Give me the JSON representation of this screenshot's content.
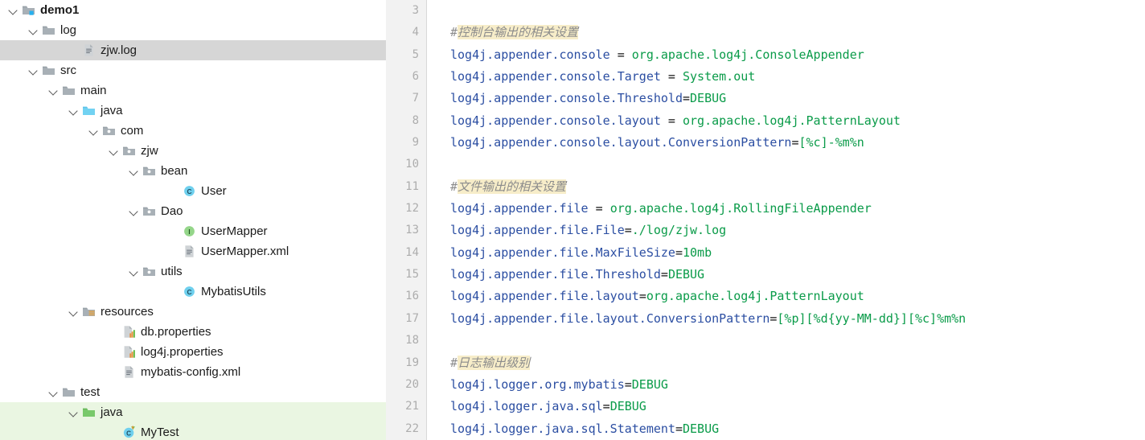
{
  "sidebar": {
    "name": "project-tree",
    "selected_item": "zjw.log",
    "highlight_colors": {
      "selected_row": "#d6d6d6",
      "test_source_root_row": "#eaf6e2"
    },
    "items": [
      {
        "label": "demo1",
        "icon": "module-folder-icon",
        "depth": 1,
        "arrow": "open",
        "bold": true,
        "state": "normal"
      },
      {
        "label": "log",
        "icon": "folder-icon",
        "depth": 2,
        "arrow": "open",
        "bold": false,
        "state": "normal"
      },
      {
        "label": "zjw.log",
        "icon": "text-file-icon",
        "depth": 4,
        "arrow": "none",
        "bold": false,
        "state": "selected"
      },
      {
        "label": "src",
        "icon": "folder-icon",
        "depth": 2,
        "arrow": "open",
        "bold": false,
        "state": "normal"
      },
      {
        "label": "main",
        "icon": "folder-icon",
        "depth": 3,
        "arrow": "open",
        "bold": false,
        "state": "normal"
      },
      {
        "label": "java",
        "icon": "source-root-folder-icon",
        "depth": 4,
        "arrow": "open",
        "bold": false,
        "state": "normal"
      },
      {
        "label": "com",
        "icon": "package-folder-icon",
        "depth": 5,
        "arrow": "open",
        "bold": false,
        "state": "normal"
      },
      {
        "label": "zjw",
        "icon": "package-folder-icon",
        "depth": 6,
        "arrow": "open",
        "bold": false,
        "state": "normal"
      },
      {
        "label": "bean",
        "icon": "package-folder-icon",
        "depth": 7,
        "arrow": "open",
        "bold": false,
        "state": "normal"
      },
      {
        "label": "User",
        "icon": "java-class-icon",
        "depth": 9,
        "arrow": "none",
        "bold": false,
        "state": "normal"
      },
      {
        "label": "Dao",
        "icon": "package-folder-icon",
        "depth": 7,
        "arrow": "open",
        "bold": false,
        "state": "normal"
      },
      {
        "label": "UserMapper",
        "icon": "java-interface-icon",
        "depth": 9,
        "arrow": "none",
        "bold": false,
        "state": "normal"
      },
      {
        "label": "UserMapper.xml",
        "icon": "xml-file-icon",
        "depth": 9,
        "arrow": "none",
        "bold": false,
        "state": "normal"
      },
      {
        "label": "utils",
        "icon": "package-folder-icon",
        "depth": 7,
        "arrow": "open",
        "bold": false,
        "state": "normal"
      },
      {
        "label": "MybatisUtils",
        "icon": "java-class-icon",
        "depth": 9,
        "arrow": "none",
        "bold": false,
        "state": "normal"
      },
      {
        "label": "resources",
        "icon": "resource-root-folder-icon",
        "depth": 4,
        "arrow": "open",
        "bold": false,
        "state": "normal"
      },
      {
        "label": "db.properties",
        "icon": "properties-file-icon",
        "depth": 6,
        "arrow": "none",
        "bold": false,
        "state": "normal"
      },
      {
        "label": "log4j.properties",
        "icon": "properties-file-icon",
        "depth": 6,
        "arrow": "none",
        "bold": false,
        "state": "normal"
      },
      {
        "label": "mybatis-config.xml",
        "icon": "xml-file-icon",
        "depth": 6,
        "arrow": "none",
        "bold": false,
        "state": "normal"
      },
      {
        "label": "test",
        "icon": "folder-icon",
        "depth": 3,
        "arrow": "open",
        "bold": false,
        "state": "normal"
      },
      {
        "label": "java",
        "icon": "test-root-folder-icon",
        "depth": 4,
        "arrow": "open",
        "bold": false,
        "state": "test-root"
      },
      {
        "label": "MyTest",
        "icon": "java-test-class-icon",
        "depth": 6,
        "arrow": "none",
        "bold": false,
        "state": "test-root"
      }
    ]
  },
  "editor": {
    "name": "code-editor",
    "file": "log4j.properties",
    "first_line_number": 3,
    "line_numbers": [
      3,
      4,
      5,
      6,
      7,
      8,
      9,
      10,
      11,
      12,
      13,
      14,
      15,
      16,
      17,
      18,
      19,
      20,
      21,
      22
    ],
    "colors": {
      "gutter_bg": "#f2f2f2",
      "line_number": "#adadad",
      "key": "#2b4ea2",
      "value": "#0a9b49",
      "comment": "#8c8c8c",
      "comment_highlight": "#f7edc9"
    },
    "lines": [
      {
        "n": 3,
        "type": "blank",
        "text": ""
      },
      {
        "n": 4,
        "type": "comment",
        "hash": "#",
        "text": "控制台输出的相关设置"
      },
      {
        "n": 5,
        "type": "prop",
        "key": "log4j.appender.console",
        "sep": " = ",
        "value": "org.apache.log4j.ConsoleAppender"
      },
      {
        "n": 6,
        "type": "prop",
        "key": "log4j.appender.console.Target",
        "sep": " = ",
        "value": "System.out"
      },
      {
        "n": 7,
        "type": "prop",
        "key": "log4j.appender.console.Threshold",
        "sep": "=",
        "value": "DEBUG"
      },
      {
        "n": 8,
        "type": "prop",
        "key": "log4j.appender.console.layout",
        "sep": " = ",
        "value": "org.apache.log4j.PatternLayout"
      },
      {
        "n": 9,
        "type": "prop",
        "key": "log4j.appender.console.layout.ConversionPattern",
        "sep": "=",
        "value": "[%c]-%m%n"
      },
      {
        "n": 10,
        "type": "blank",
        "text": ""
      },
      {
        "n": 11,
        "type": "comment",
        "hash": "#",
        "text": "文件输出的相关设置"
      },
      {
        "n": 12,
        "type": "prop",
        "key": "log4j.appender.file",
        "sep": " = ",
        "value": "org.apache.log4j.RollingFileAppender"
      },
      {
        "n": 13,
        "type": "prop",
        "key": "log4j.appender.file.File",
        "sep": "=",
        "value": "./log/zjw.log"
      },
      {
        "n": 14,
        "type": "prop",
        "key": "log4j.appender.file.MaxFileSize",
        "sep": "=",
        "value": "10mb"
      },
      {
        "n": 15,
        "type": "prop",
        "key": "log4j.appender.file.Threshold",
        "sep": "=",
        "value": "DEBUG"
      },
      {
        "n": 16,
        "type": "prop",
        "key": "log4j.appender.file.layout",
        "sep": "=",
        "value": "org.apache.log4j.PatternLayout"
      },
      {
        "n": 17,
        "type": "prop",
        "key": "log4j.appender.file.layout.ConversionPattern",
        "sep": "=",
        "value": "[%p][%d{yy-MM-dd}][%c]%m%n"
      },
      {
        "n": 18,
        "type": "blank",
        "text": ""
      },
      {
        "n": 19,
        "type": "comment",
        "hash": "#",
        "text": "日志输出级别"
      },
      {
        "n": 20,
        "type": "prop",
        "key": "log4j.logger.org.mybatis",
        "sep": "=",
        "value": "DEBUG"
      },
      {
        "n": 21,
        "type": "prop",
        "key": "log4j.logger.java.sql",
        "sep": "=",
        "value": "DEBUG"
      },
      {
        "n": 22,
        "type": "prop",
        "key": "log4j.logger.java.sql.Statement",
        "sep": "=",
        "value": "DEBUG"
      }
    ]
  }
}
